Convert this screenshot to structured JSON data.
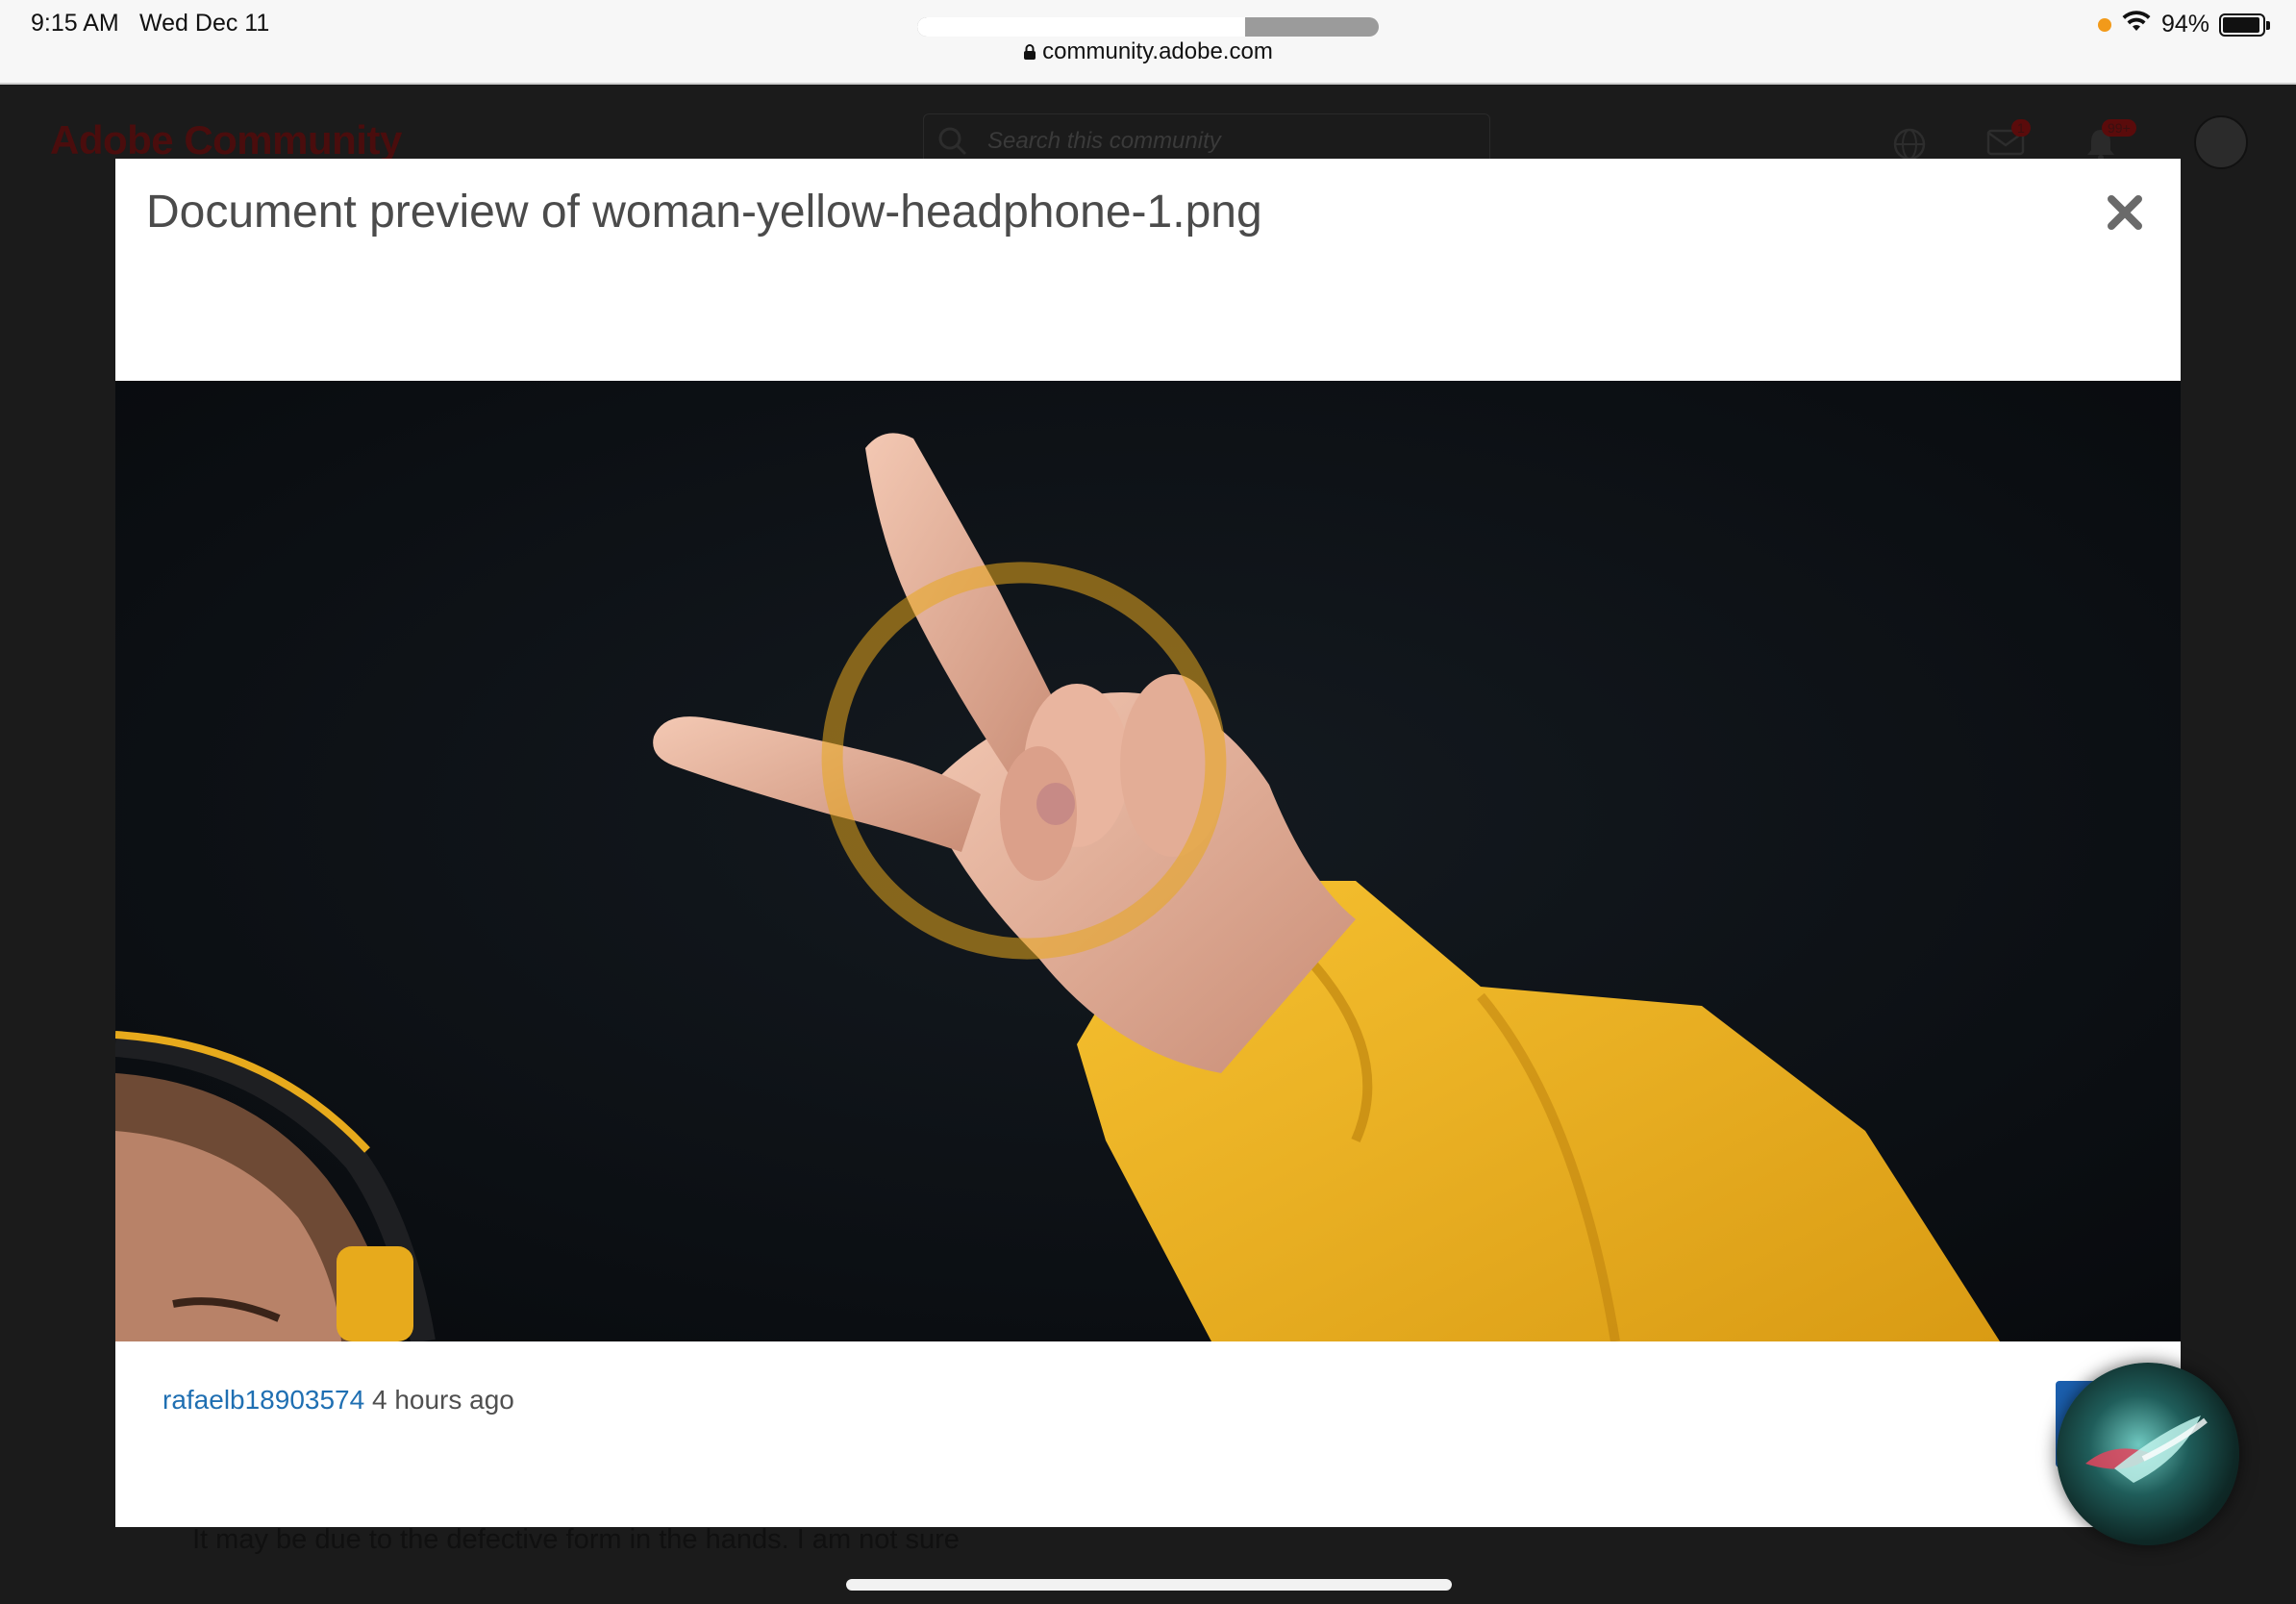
{
  "status_bar": {
    "time": "9:15 AM",
    "date": "Wed Dec 11",
    "battery_percent": "94%",
    "battery_level": 0.94,
    "page_load_progress": 0.71,
    "url": "community.adobe.com"
  },
  "site": {
    "logo": "Adobe Community",
    "search_placeholder": "Search this community",
    "messages_badge": "1",
    "notifications_badge": "99+",
    "post_text": "It may be due to the defective form in the hands. I am not sure"
  },
  "modal": {
    "title": "Document preview of woman-yellow-headphone-1.png",
    "close_icon": "close-icon",
    "image_alt": "woman-yellow-headphone-1.png",
    "author": "rafaelb18903574",
    "time_ago": "4 hours ago"
  },
  "colors": {
    "link": "#1f6fb2",
    "modal_bg": "#ffffff",
    "overlay": "#1b1b1b",
    "sweater_yellow": "#f0b323"
  }
}
